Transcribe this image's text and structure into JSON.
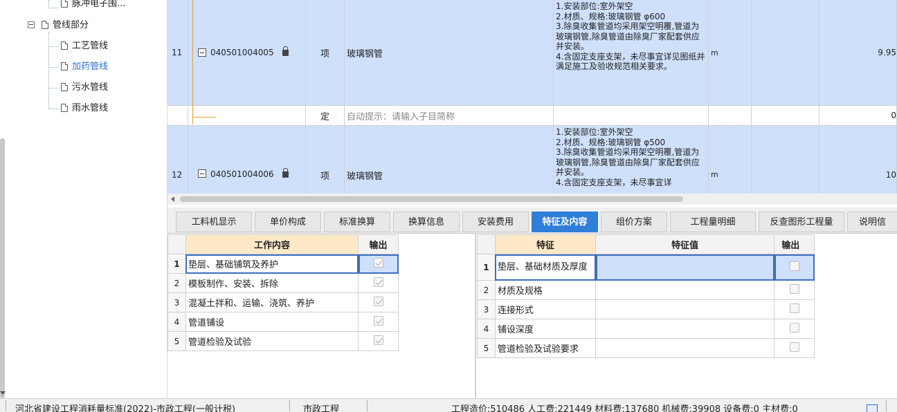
{
  "tree": {
    "top_item": "脉冲电子围...",
    "group": "管线部分",
    "children": [
      "工艺管线",
      "加药管线",
      "污水管线",
      "雨水管线"
    ]
  },
  "grid": {
    "rows": [
      {
        "num": "11",
        "code": "040501004005",
        "type": "项",
        "name": "玻璃钢管",
        "desc": "1.安装部位:室外架空\n2.材质、规格:玻璃钢管 φ600\n3.除臭收集管道均采用架空明覆,管道为玻璃钢管,除臭管道由除臭厂家配套供应并安装。\n4.含固定支座支架，未尽事宜详见图纸并满足施工及验收规范相关要求。",
        "unit": "m",
        "qty": "9.95"
      },
      {
        "num": "",
        "code": "",
        "type": "定",
        "name": "自动提示：请输入子目简称",
        "desc": "",
        "unit": "",
        "qty": "0"
      },
      {
        "num": "12",
        "code": "040501004006",
        "type": "项",
        "name": "玻璃钢管",
        "desc": "1.安装部位:室外架空\n2.材质、规格:玻璃钢管 φ500\n3.除臭收集管道均采用架空明覆,管道为玻璃钢管,除臭管道由除臭厂家配套供应并安装。\n4.含固定支座支架，未尽事宜详",
        "unit": "m",
        "qty": "10"
      }
    ]
  },
  "tabs": [
    "工料机显示",
    "单价构成",
    "标准换算",
    "换算信息",
    "安装费用",
    "特征及内容",
    "组价方案",
    "工程量明细",
    "反查图形工程量",
    "说明信"
  ],
  "active_tab": "特征及内容",
  "work": {
    "headers": [
      "工作内容",
      "输出"
    ],
    "rows": [
      {
        "idx": "1",
        "text": "垫层、基础铺筑及养护"
      },
      {
        "idx": "2",
        "text": "模板制作、安装、拆除"
      },
      {
        "idx": "3",
        "text": "混凝土拌和、运输、浇筑、养护"
      },
      {
        "idx": "4",
        "text": "管道铺设"
      },
      {
        "idx": "5",
        "text": "管道检验及试验"
      }
    ]
  },
  "feature": {
    "headers": [
      "特征",
      "特征值",
      "输出"
    ],
    "rows": [
      {
        "idx": "1",
        "text": "垫层、基础材质及厚度"
      },
      {
        "idx": "2",
        "text": "材质及规格"
      },
      {
        "idx": "3",
        "text": "连接形式"
      },
      {
        "idx": "4",
        "text": "铺设深度"
      },
      {
        "idx": "5",
        "text": "管道检验及试验要求"
      }
    ]
  },
  "status": {
    "standard": "河北省建设工程消耗量标准(2022)-市政工程(一般计税)",
    "project_type": "市政工程",
    "summary": "工程造价:510486   人工费:221449   材料费:137680   机械费:39908   设备费:0   主材费:0"
  }
}
